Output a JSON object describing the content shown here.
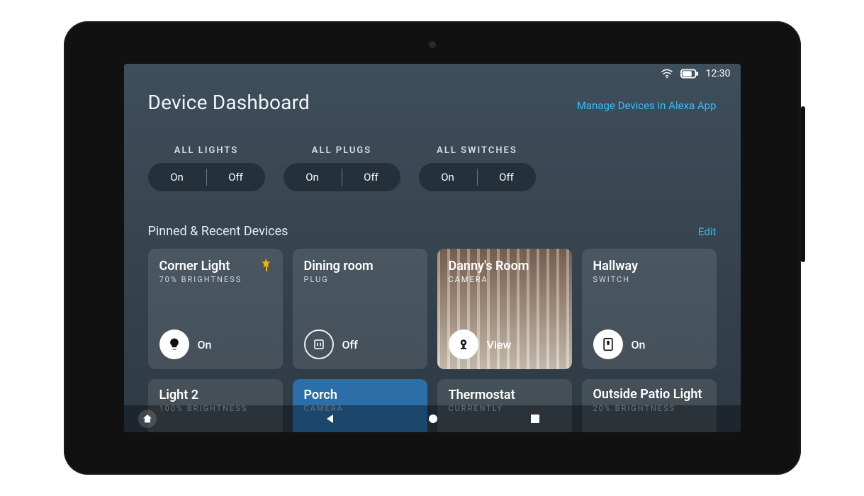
{
  "status": {
    "time": "12:30"
  },
  "header": {
    "title": "Device Dashboard",
    "manage_link": "Manage Devices in Alexa App"
  },
  "groups": [
    {
      "label": "ALL LIGHTS",
      "on": "On",
      "off": "Off"
    },
    {
      "label": "ALL PLUGS",
      "on": "On",
      "off": "Off"
    },
    {
      "label": "ALL SWITCHES",
      "on": "On",
      "off": "Off"
    }
  ],
  "pinned": {
    "title": "Pinned & Recent Devices",
    "edit": "Edit"
  },
  "cards_row1": [
    {
      "name": "Corner Light",
      "sub": "70% BRIGHTNESS",
      "state": "On",
      "kind": "light",
      "pinned": true
    },
    {
      "name": "Dining room",
      "sub": "PLUG",
      "state": "Off",
      "kind": "plug",
      "pinned": false
    },
    {
      "name": "Danny's Room",
      "sub": "CAMERA",
      "state": "View",
      "kind": "camera",
      "pinned": false
    },
    {
      "name": "Hallway",
      "sub": "SWITCH",
      "state": "On",
      "kind": "switch",
      "pinned": false
    }
  ],
  "cards_row2": [
    {
      "name": "Light 2",
      "sub": "100% BRIGHTNESS"
    },
    {
      "name": "Porch",
      "sub": "CAMERA"
    },
    {
      "name": "Thermostat",
      "sub": "CURRENTLY"
    },
    {
      "name": "Outside Patio Light",
      "sub": "20% BRIGHTNESS"
    }
  ]
}
